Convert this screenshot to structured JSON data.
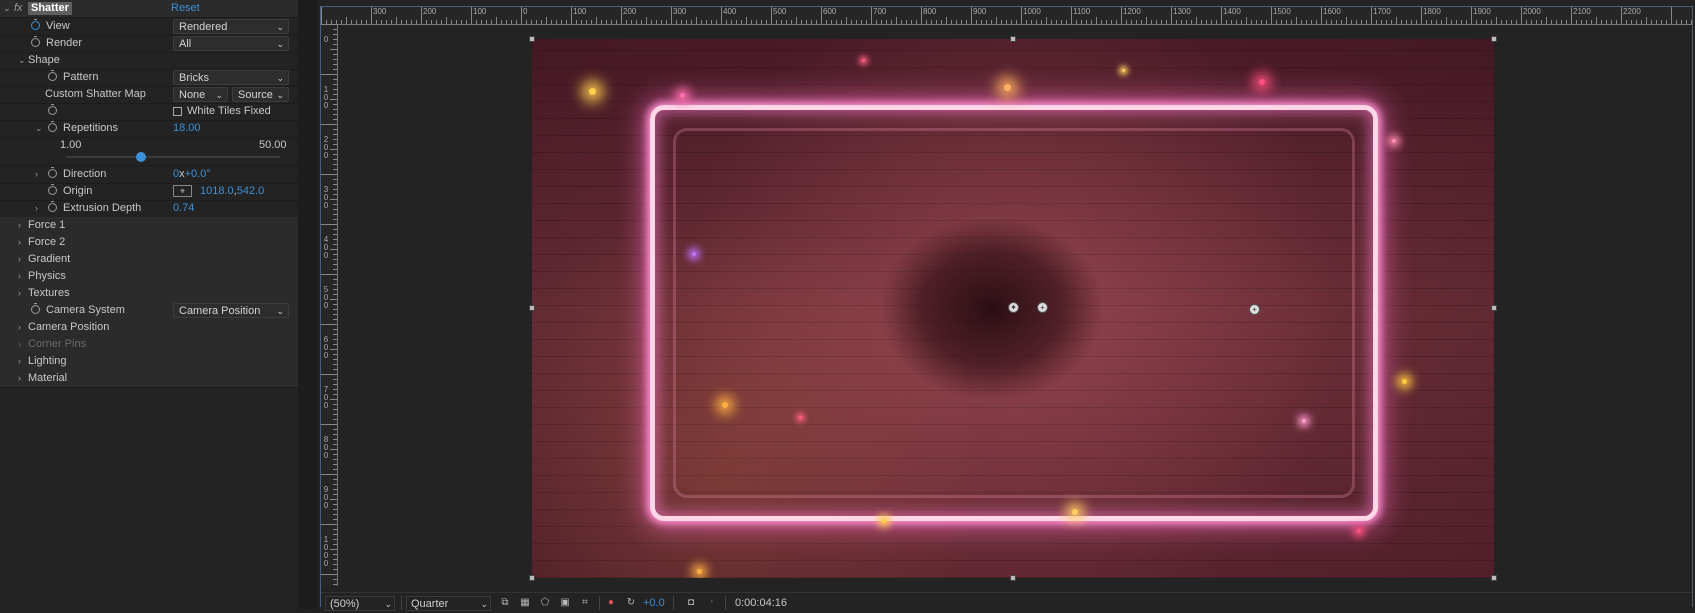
{
  "effect": {
    "fx_label": "fx",
    "name": "Shatter",
    "reset": "Reset"
  },
  "props": {
    "view": {
      "label": "View",
      "value": "Rendered"
    },
    "render": {
      "label": "Render",
      "value": "All"
    },
    "shape": {
      "label": "Shape"
    },
    "pattern": {
      "label": "Pattern",
      "value": "Bricks"
    },
    "custom_map": {
      "label": "Custom Shatter Map",
      "value": "None",
      "source": "Source"
    },
    "white_tiles": {
      "label": "White Tiles Fixed"
    },
    "repetitions": {
      "label": "Repetitions",
      "value": "18.00",
      "min": "1.00",
      "max": "50.00",
      "fraction": 0.35
    },
    "direction": {
      "label": "Direction",
      "value_prefix": "0",
      "value_x": "x",
      "value_suffix": "+0.0°"
    },
    "origin": {
      "label": "Origin",
      "value_a": "1018.0",
      "value_sep": ",",
      "value_b": "542.0"
    },
    "extrusion": {
      "label": "Extrusion Depth",
      "value": "0.74"
    },
    "force1": {
      "label": "Force 1"
    },
    "force2": {
      "label": "Force 2"
    },
    "gradient": {
      "label": "Gradient"
    },
    "physics": {
      "label": "Physics"
    },
    "textures": {
      "label": "Textures"
    },
    "camera_system": {
      "label": "Camera System",
      "value": "Camera Position"
    },
    "camera_position": {
      "label": "Camera Position"
    },
    "corner_pins": {
      "label": "Corner Pins"
    },
    "lighting": {
      "label": "Lighting"
    },
    "material": {
      "label": "Material"
    }
  },
  "ruler": {
    "top": [
      "300",
      "200",
      "100",
      "0",
      "100",
      "200",
      "300",
      "400",
      "500",
      "600",
      "700",
      "800",
      "900",
      "1000",
      "1100",
      "1200",
      "1300",
      "1400",
      "1500",
      "1600",
      "1700",
      "1800",
      "1900",
      "2000",
      "2100",
      "2200"
    ],
    "left": [
      "0",
      "100",
      "200",
      "300",
      "400",
      "500",
      "600",
      "700",
      "800",
      "900",
      "1000"
    ]
  },
  "toolbar": {
    "zoom": "(50%)",
    "resolution": "Quarter",
    "exposure": "+0.0",
    "timecode": "0:00:04:16"
  },
  "colors": {
    "accent_blue": "#3d8fd6",
    "neon": "#ffd7e6"
  }
}
